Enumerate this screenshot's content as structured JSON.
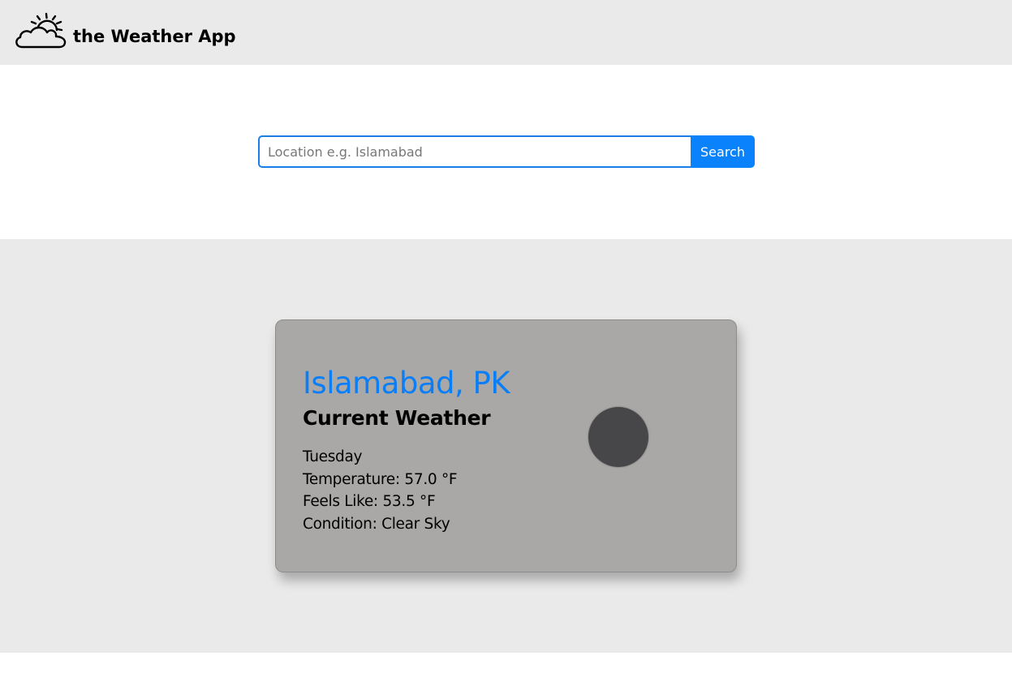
{
  "navbar": {
    "icon": "cloud-sun-icon",
    "title": "the Weather App"
  },
  "search": {
    "placeholder": "Location e.g. Islamabad",
    "value": "",
    "button_label": "Search"
  },
  "weather": {
    "location": "Islamabad, PK",
    "heading": "Current Weather",
    "day": "Tuesday",
    "temperature": "Temperature: 57.0 °F",
    "feels_like": "Feels Like: 53.5 °F",
    "condition": "Condition: Clear Sky",
    "icon": "clear-sky-icon"
  },
  "colors": {
    "accent": "#0a82fb",
    "location_text": "#0a7ef6",
    "card_background": "#a9a8a6",
    "section_background": "#eaeaea"
  }
}
